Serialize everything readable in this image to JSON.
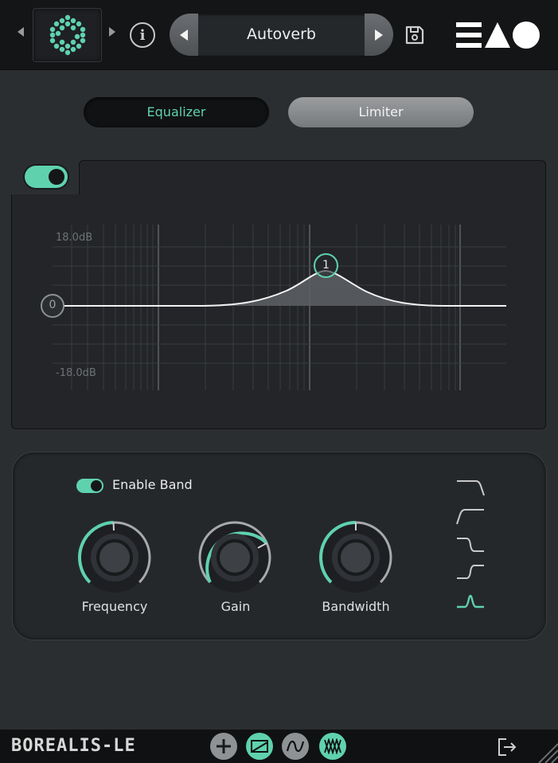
{
  "header": {
    "preset_name": "Autoverb",
    "brand_colors": {
      "accent": "#5fd2ad",
      "logo": "#ffffff"
    }
  },
  "tabs": [
    {
      "label": "Equalizer",
      "active": true
    },
    {
      "label": "Limiter",
      "active": false
    }
  ],
  "eq": {
    "enabled": true,
    "gain_top_label": "18.0dB",
    "gain_bottom_label": "-18.0dB",
    "output_node_label": "0",
    "band_node_label": "1"
  },
  "band": {
    "enable_label": "Enable Band",
    "enabled": true,
    "knobs": [
      {
        "label": "Frequency",
        "value": 0.49
      },
      {
        "label": "Gain",
        "value": 0.7
      },
      {
        "label": "Bandwidth",
        "value": 0.5
      }
    ],
    "filter_types": [
      "high-cut-icon",
      "low-cut-icon",
      "high-shelf-icon",
      "low-shelf-icon",
      "bell-icon"
    ],
    "selected_filter": "bell-icon"
  },
  "footer": {
    "product": "BOREALIS-LE"
  }
}
